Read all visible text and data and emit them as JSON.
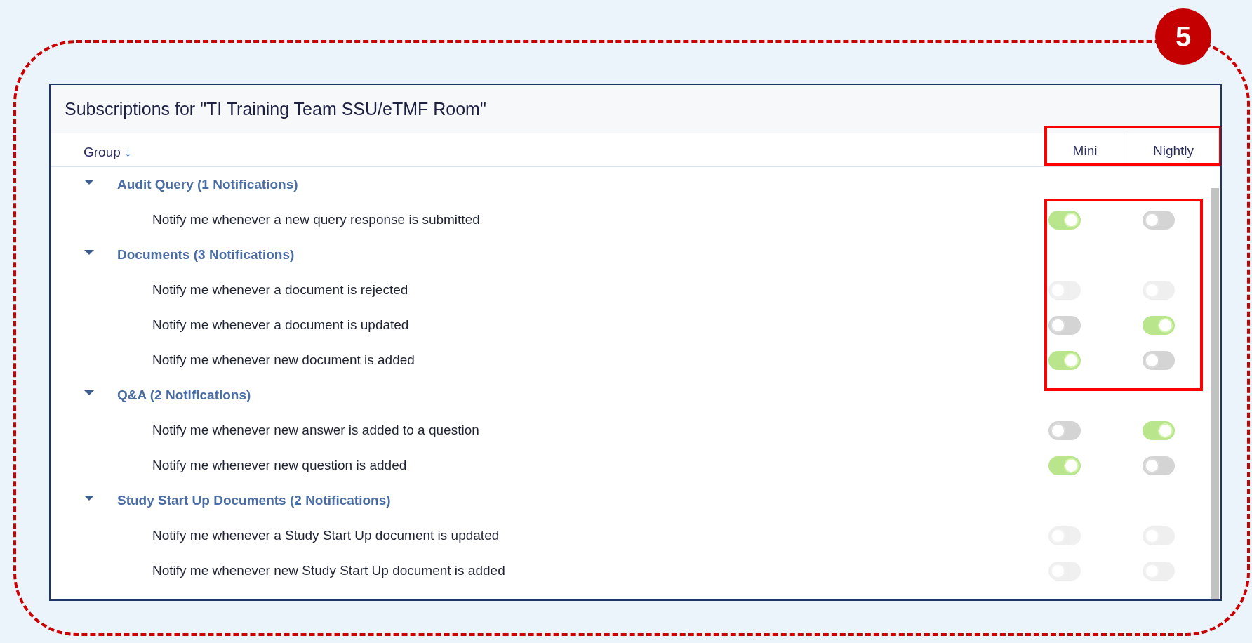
{
  "annotation": {
    "badge": "5"
  },
  "panel": {
    "title": "Subscriptions for \"TI Training Team SSU/eTMF Room\"",
    "columns": [
      {
        "label": "Group",
        "sort_indicator": "↓"
      },
      {
        "label": "Mini"
      },
      {
        "label": "Nightly"
      }
    ]
  },
  "groups": [
    {
      "label": "Audit Query (1 Notifications)",
      "expanded": true,
      "items": [
        {
          "label": "Notify me whenever a new query response is submitted",
          "mini": {
            "on": true,
            "disabled": false
          },
          "nightly": {
            "on": false,
            "disabled": false
          }
        }
      ]
    },
    {
      "label": "Documents (3 Notifications)",
      "expanded": true,
      "items": [
        {
          "label": "Notify me whenever a document is rejected",
          "mini": {
            "on": false,
            "disabled": true
          },
          "nightly": {
            "on": false,
            "disabled": true
          }
        },
        {
          "label": "Notify me whenever a document is updated",
          "mini": {
            "on": false,
            "disabled": false
          },
          "nightly": {
            "on": true,
            "disabled": false
          }
        },
        {
          "label": "Notify me whenever new document is added",
          "mini": {
            "on": true,
            "disabled": false
          },
          "nightly": {
            "on": false,
            "disabled": false
          }
        }
      ]
    },
    {
      "label": "Q&A (2 Notifications)",
      "expanded": true,
      "items": [
        {
          "label": "Notify me whenever new answer is added to a question",
          "mini": {
            "on": false,
            "disabled": false
          },
          "nightly": {
            "on": true,
            "disabled": false
          }
        },
        {
          "label": "Notify me whenever new question is added",
          "mini": {
            "on": true,
            "disabled": false
          },
          "nightly": {
            "on": false,
            "disabled": false
          }
        }
      ]
    },
    {
      "label": "Study Start Up Documents (2 Notifications)",
      "expanded": true,
      "items": [
        {
          "label": "Notify me whenever a Study Start Up document is updated",
          "mini": {
            "on": false,
            "disabled": true
          },
          "nightly": {
            "on": false,
            "disabled": true
          }
        },
        {
          "label": "Notify me whenever new Study Start Up document is added",
          "mini": {
            "on": false,
            "disabled": true
          },
          "nightly": {
            "on": false,
            "disabled": true
          }
        }
      ]
    }
  ]
}
